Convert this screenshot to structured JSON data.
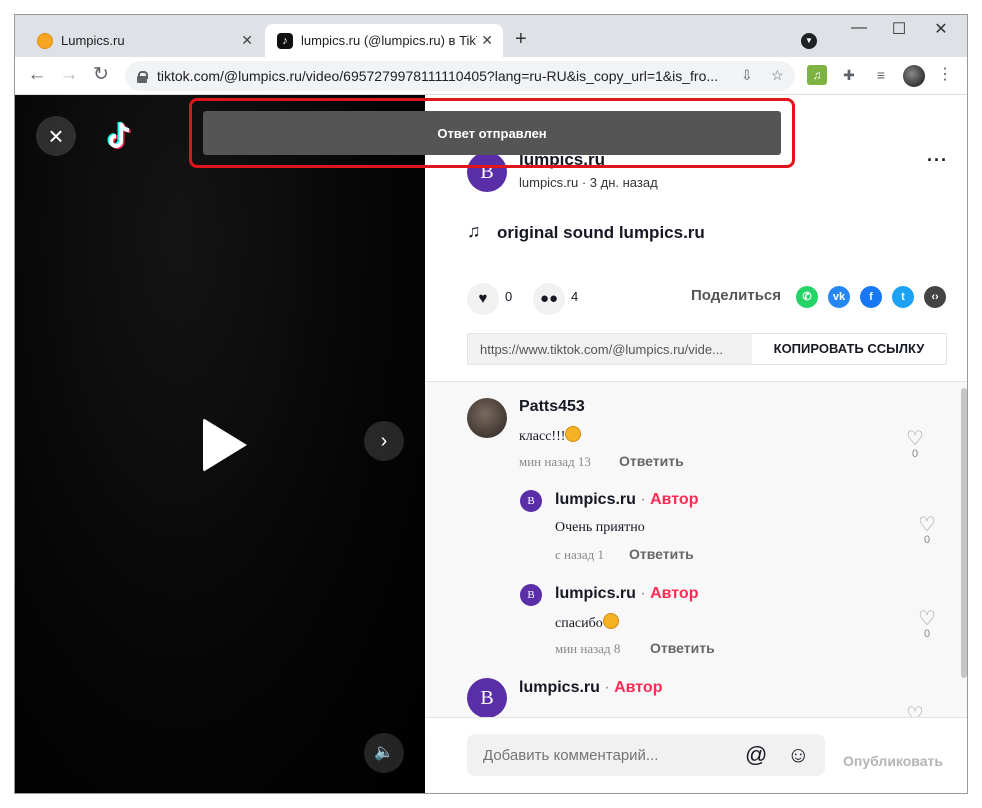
{
  "tabs": [
    {
      "title": "Lumpics.ru",
      "close": "✕"
    },
    {
      "title": "lumpics.ru (@lumpics.ru) в TikTok",
      "close": "✕"
    }
  ],
  "newtab": "+",
  "window_controls": {
    "minimize": "—",
    "maximize": "☐",
    "close": "✕"
  },
  "address": {
    "url": "tiktok.com/@lumpics.ru/video/6957279978111110405?lang=ru-RU&is_copy_url=1&is_fro..."
  },
  "toast": {
    "text": "Ответ отправлен"
  },
  "author": {
    "avatar_letter": "B",
    "name": "lumpics.ru",
    "subtitle": "lumpics.ru · 3 дн. назад",
    "more": "···"
  },
  "sound": {
    "icon": "music-note-icon",
    "title": "original sound lumpics.ru"
  },
  "actions": {
    "likes": "0",
    "comments": "4",
    "share_label": "Поделиться"
  },
  "share_icons": [
    {
      "name": "whatsapp-icon",
      "color": "#25d366",
      "glyph": "✆"
    },
    {
      "name": "vk-icon",
      "color": "#2787f5",
      "glyph": "vk"
    },
    {
      "name": "facebook-icon",
      "color": "#1877f2",
      "glyph": "f"
    },
    {
      "name": "twitter-icon",
      "color": "#1da1f2",
      "glyph": "t"
    },
    {
      "name": "embed-icon",
      "color": "#444444",
      "glyph": "‹›"
    }
  ],
  "link": {
    "value": "https://www.tiktok.com/@lumpics.ru/vide...",
    "copy_label": "КОПИРОВАТЬ ССЫЛКУ"
  },
  "comments": [
    {
      "name": "Patts453",
      "text": "класс!!!",
      "time": "мин назад 13",
      "reply": "Ответить",
      "likes": "0"
    },
    {
      "name": "lumpics.ru",
      "author_tag": "Автор",
      "text": "Очень приятно",
      "time": "с назад 1",
      "reply": "Ответить",
      "likes": "0"
    },
    {
      "name": "lumpics.ru",
      "author_tag": "Автор",
      "text": "спасибо",
      "time": "мин назад 8",
      "reply": "Ответить",
      "likes": "0"
    },
    {
      "name": "lumpics.ru",
      "author_tag": "Автор"
    }
  ],
  "comment_input": {
    "placeholder": "Добавить комментарий...",
    "publish": "Опубликовать"
  },
  "colors": {
    "accent": "#fe2c55",
    "avatar": "#5a2ea6",
    "highlight": "#e0141a"
  }
}
